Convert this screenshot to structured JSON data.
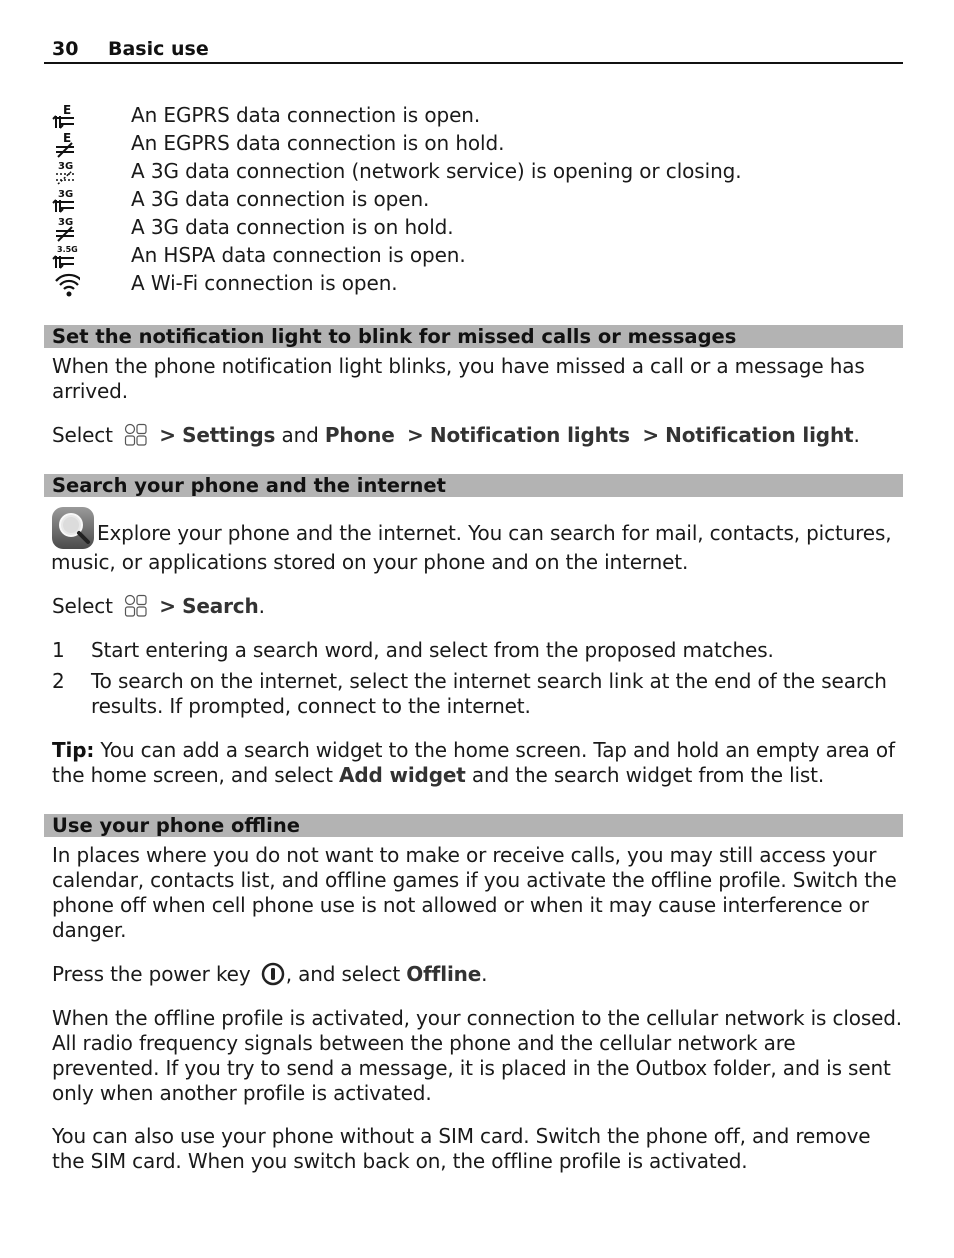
{
  "header": {
    "page_number": "30",
    "title": "Basic use"
  },
  "connection_icons": [
    {
      "icon": "egprs-open-icon",
      "label": "E",
      "text": "An EGPRS data connection is open."
    },
    {
      "icon": "egprs-hold-icon",
      "label": "E",
      "text": "An EGPRS data connection is on hold."
    },
    {
      "icon": "3g-opening-closing-icon",
      "label": "3G",
      "text": "A 3G data connection (network service) is opening or closing."
    },
    {
      "icon": "3g-open-icon",
      "label": "3G",
      "text": "A 3G data connection is open."
    },
    {
      "icon": "3g-hold-icon",
      "label": "3G",
      "text": "A 3G data connection is on hold."
    },
    {
      "icon": "hspa-open-icon",
      "label": "3.5G",
      "text": "An HSPA data connection is open."
    },
    {
      "icon": "wifi-icon",
      "label": "",
      "text": "A Wi-Fi connection is open."
    }
  ],
  "sections": {
    "notification": {
      "heading": "Set the notification light to blink for missed calls or messages",
      "intro": "When the phone notification light blinks, you have missed a call or a message has arrived.",
      "select_word": "Select",
      "path_sep": ">",
      "settings": "Settings",
      "and": "and",
      "phone": "Phone",
      "notification_lights": "Notification lights",
      "notification_light": "Notification light",
      "end": "."
    },
    "search": {
      "heading": "Search your phone and the internet",
      "intro": "Explore your phone and the internet. You can search for mail, contacts, pictures, music, or applications stored on your phone and on the internet.",
      "select_word": "Select",
      "path_sep": ">",
      "search_label": "Search",
      "end": ".",
      "steps": [
        {
          "n": "1",
          "text": "Start entering a search word, and select from the proposed matches."
        },
        {
          "n": "2",
          "text": "To search on the internet, select the internet search link at the end of the search results. If prompted, connect to the internet."
        }
      ],
      "tip_label": "Tip:",
      "tip_text_1": " You can add a search widget to the home screen. Tap and hold an empty area of the home screen, and select ",
      "tip_bold": "Add widget",
      "tip_text_2": " and the search widget from the list."
    },
    "offline": {
      "heading": "Use your phone offline",
      "intro": "In places where you do not want to make or receive calls, you may still access your calendar, contacts list, and offline games if you activate the offline profile. Switch the phone off when cell phone use is not allowed or when it may cause interference or danger.",
      "press_text": "Press the power key",
      "press_text_2": ", and select",
      "offline_label": "Offline",
      "end": ".",
      "para2": "When the offline profile is activated, your connection to the cellular network is closed. All radio frequency signals between the phone and the cellular network are prevented. If you try to send a message, it is placed in the Outbox folder, and is sent only when another profile is activated.",
      "para3": "You can also use your phone without a SIM card. Switch the phone off, and remove the SIM card. When you switch back on, the offline profile is activated."
    }
  }
}
